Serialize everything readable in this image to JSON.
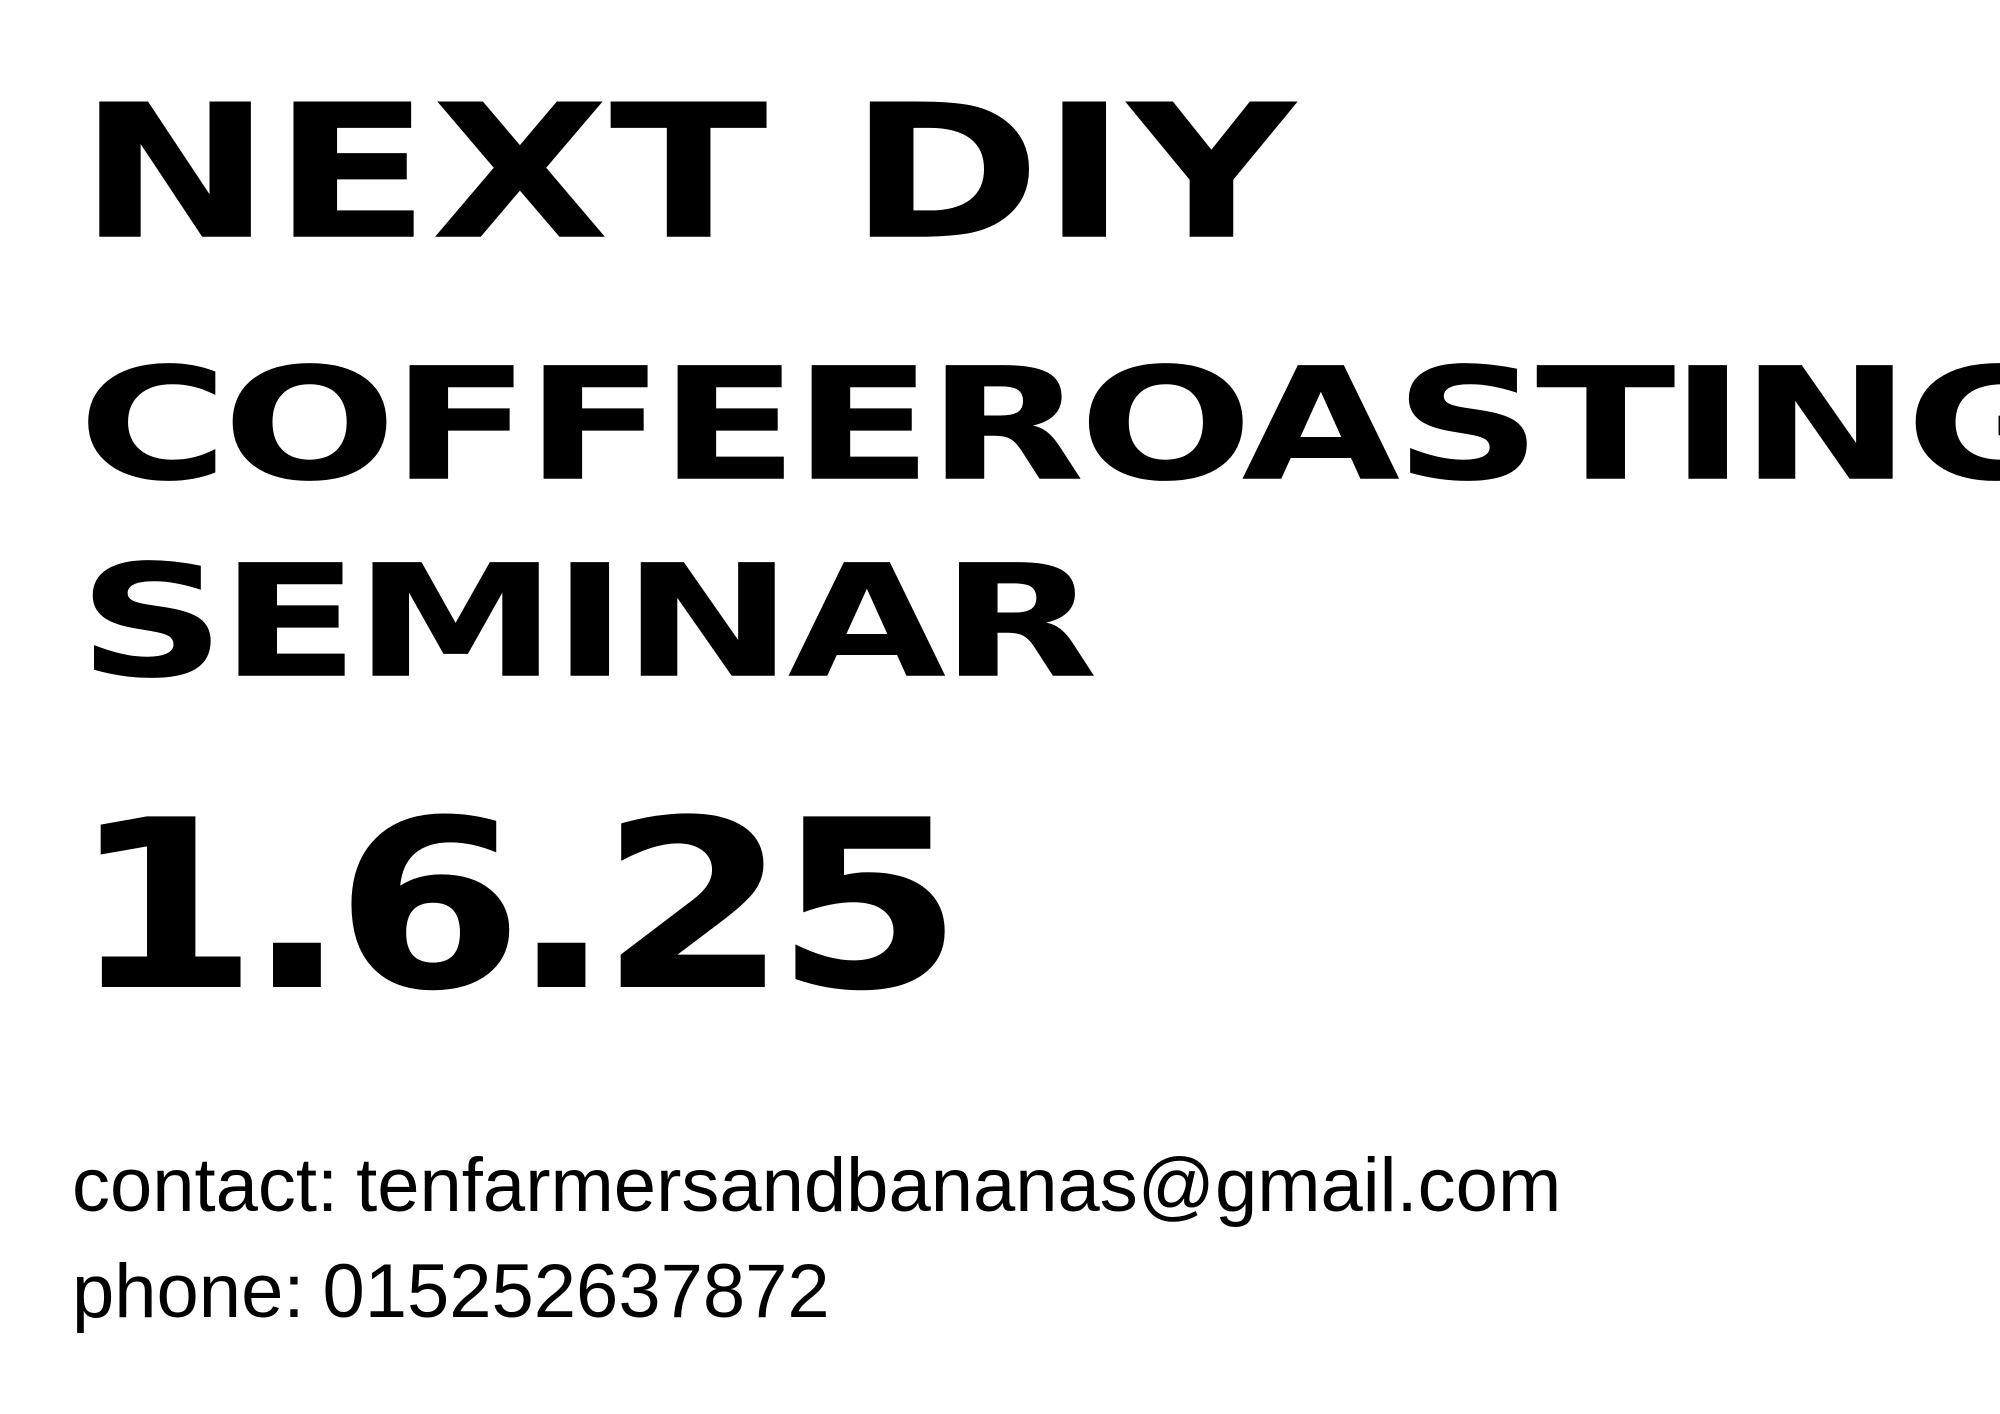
{
  "poster": {
    "headline": {
      "line1": "NEXT DIY",
      "line2": "COFFEEROASTING",
      "line3": "SEMINAR"
    },
    "date": "1.6.25",
    "contact": {
      "email_label": "contact:",
      "email": "tenfarmersandbananas@gmail.com",
      "phone_label": "phone:",
      "phone": "015252637872"
    }
  },
  "colors": {
    "background": "#ffffff",
    "text": "#000000"
  }
}
